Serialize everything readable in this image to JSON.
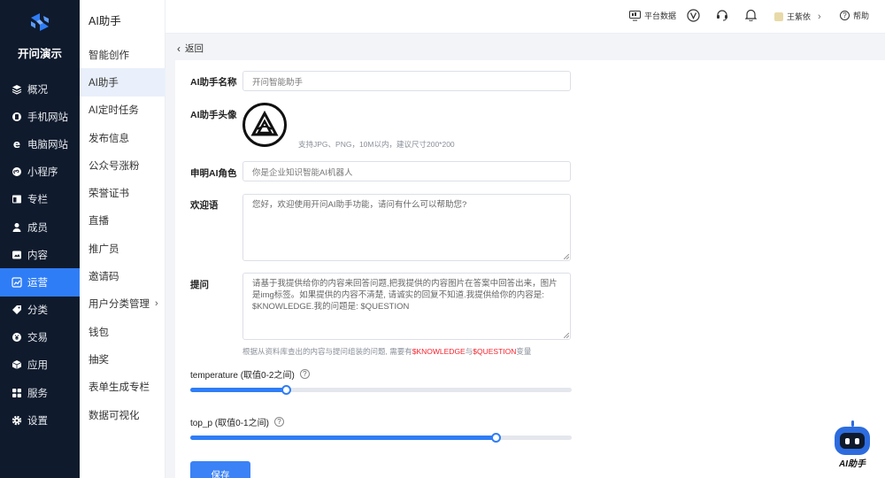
{
  "brand": {
    "name": "开问演示"
  },
  "nav": {
    "items": [
      {
        "label": "概况",
        "icon": "layers-icon"
      },
      {
        "label": "手机网站",
        "icon": "mobile-icon"
      },
      {
        "label": "电脑网站",
        "icon": "ie-icon"
      },
      {
        "label": "小程序",
        "icon": "mini-program-icon"
      },
      {
        "label": "专栏",
        "icon": "column-icon"
      },
      {
        "label": "成员",
        "icon": "user-icon"
      },
      {
        "label": "内容",
        "icon": "content-icon"
      },
      {
        "label": "运营",
        "icon": "chart-icon",
        "active": true
      },
      {
        "label": "分类",
        "icon": "tag-icon"
      },
      {
        "label": "交易",
        "icon": "yen-icon"
      },
      {
        "label": "应用",
        "icon": "cube-icon"
      },
      {
        "label": "服务",
        "icon": "grid-icon"
      },
      {
        "label": "设置",
        "icon": "gear-icon"
      }
    ]
  },
  "submenu": {
    "title": "AI助手",
    "items": [
      "智能创作",
      "AI助手",
      "AI定时任务",
      "发布信息",
      "公众号涨粉",
      "荣誉证书",
      "直播",
      "推广员",
      "邀请码",
      "用户分类管理",
      "钱包",
      "抽奖",
      "表单生成专栏",
      "数据可视化"
    ]
  },
  "topbar": {
    "platform_data": "平台数据",
    "user_name": "王紫依",
    "help": "帮助"
  },
  "content": {
    "back": "返回",
    "name_label": "AI助手名称",
    "name_value": "开问智能助手",
    "avatar_label": "AI助手头像",
    "avatar_hint": "支持JPG、PNG，10M以内，建议尺寸200*200",
    "role_label": "申明AI角色",
    "role_value": "你是企业知识智能AI机器人",
    "welcome_label": "欢迎语",
    "welcome_value": "您好，欢迎使用开问AI助手功能，请问有什么可以帮助您?",
    "prompt_label": "提问",
    "prompt_value": "请基于我提供给你的内容来回答问题,把我提供的内容图片在答案中回答出来，图片是img标签。如果提供的内容不清楚, 请诚实的回复不知道.我提供给你的内容是: $KNOWLEDGE.我的问题是: $QUESTION",
    "prompt_hint_prefix": "根据从资料库查出的内容与提问组装的问题, 需要有",
    "prompt_hint_var1": "$KNOWLEDGE",
    "prompt_hint_mid": "与",
    "prompt_hint_var2": "$QUESTION",
    "prompt_hint_suffix": "变量",
    "temperature_label": "temperature (取值0-2之间)",
    "temperature_value": 0.5,
    "temperature_max": 2,
    "top_p_label": "top_p (取值0-1之间)",
    "top_p_value": 0.8,
    "top_p_max": 1,
    "save": "保存"
  },
  "bot": {
    "caption": "AI助手"
  },
  "colors": {
    "accent": "#2f7df6",
    "nav_bg": "#0f1a2c",
    "hint_red": "#f5222d"
  }
}
